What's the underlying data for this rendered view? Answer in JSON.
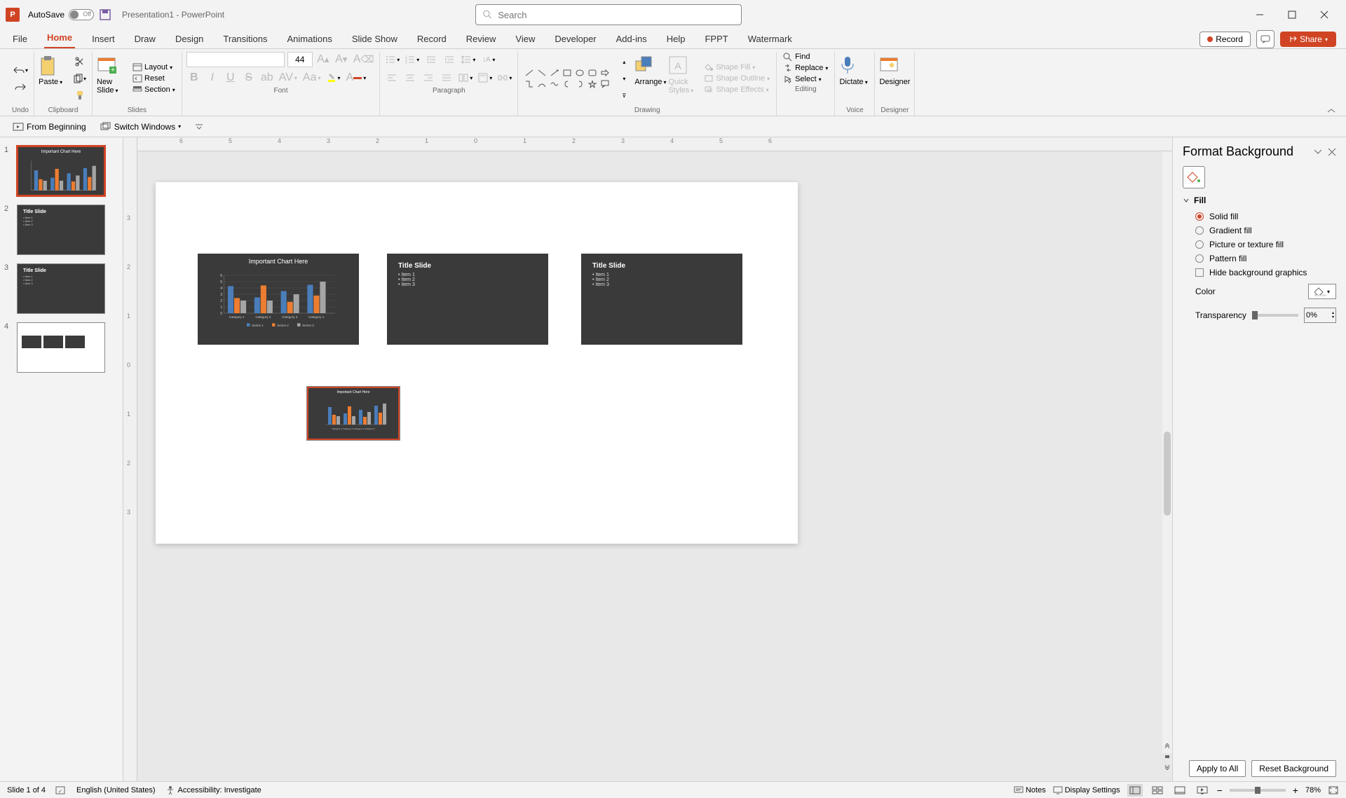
{
  "titlebar": {
    "autosave_label": "AutoSave",
    "autosave_state": "Off",
    "doc_title": "Presentation1 - PowerPoint",
    "search_placeholder": "Search"
  },
  "tabs": [
    "File",
    "Home",
    "Insert",
    "Draw",
    "Design",
    "Transitions",
    "Animations",
    "Slide Show",
    "Record",
    "Review",
    "View",
    "Developer",
    "Add-ins",
    "Help",
    "FPPT",
    "Watermark"
  ],
  "active_tab": "Home",
  "tab_right": {
    "record": "Record",
    "share": "Share"
  },
  "ribbon": {
    "undo_group": "Undo",
    "clipboard": {
      "label": "Clipboard",
      "paste": "Paste"
    },
    "slides": {
      "label": "Slides",
      "new_slide": "New Slide",
      "layout": "Layout",
      "reset": "Reset",
      "section": "Section"
    },
    "font": {
      "label": "Font",
      "size": "44"
    },
    "paragraph": {
      "label": "Paragraph"
    },
    "shapes_group": {
      "label": "Drawing",
      "arrange": "Arrange",
      "quick_styles": "Quick Styles",
      "shape_fill": "Shape Fill",
      "shape_outline": "Shape Outline",
      "shape_effects": "Shape Effects"
    },
    "editing": {
      "label": "Editing",
      "find": "Find",
      "replace": "Replace",
      "select": "Select"
    },
    "voice": {
      "label": "Voice",
      "dictate": "Dictate"
    },
    "designer": {
      "label": "Designer",
      "designer": "Designer"
    }
  },
  "qat": {
    "from_beginning": "From Beginning",
    "switch_windows": "Switch Windows"
  },
  "ruler_marks_h": [
    "6",
    "5",
    "4",
    "3",
    "2",
    "1",
    "0",
    "1",
    "2",
    "3",
    "4",
    "5",
    "6"
  ],
  "ruler_marks_v": [
    "3",
    "2",
    "1",
    "0",
    "1",
    "2",
    "3"
  ],
  "thumbnails": [
    {
      "num": "1",
      "type": "chart",
      "title": "Important Chart Here"
    },
    {
      "num": "2",
      "type": "title",
      "title": "Title Slide",
      "items": [
        "Item 1",
        "Item 2",
        "Item 3"
      ]
    },
    {
      "num": "3",
      "type": "title",
      "title": "Title Slide",
      "items": [
        "Item 1",
        "Item 2",
        "Item 3"
      ]
    },
    {
      "num": "4",
      "type": "overview"
    }
  ],
  "slide_objects": {
    "chart_slide": {
      "title": "Important Chart Here"
    },
    "title_slide_1": {
      "title": "Title Slide",
      "items": [
        "• Item 1",
        "• Item 2",
        "• Item 3"
      ]
    },
    "title_slide_2": {
      "title": "Title Slide",
      "items": [
        "• Item 1",
        "• Item 2",
        "• Item 3"
      ]
    },
    "mini_chart": {
      "title": "Important Chart Here"
    }
  },
  "format_pane": {
    "title": "Format Background",
    "section": "Fill",
    "options": {
      "solid": "Solid fill",
      "gradient": "Gradient fill",
      "picture": "Picture or texture fill",
      "pattern": "Pattern fill",
      "hide_bg": "Hide background graphics"
    },
    "color_label": "Color",
    "transparency_label": "Transparency",
    "transparency_value": "0%",
    "apply_all": "Apply to All",
    "reset": "Reset Background"
  },
  "statusbar": {
    "slide_info": "Slide 1 of 4",
    "language": "English (United States)",
    "accessibility": "Accessibility: Investigate",
    "notes": "Notes",
    "display_settings": "Display Settings",
    "zoom": "78%"
  },
  "chart_data": {
    "type": "bar",
    "title": "Important Chart Here",
    "categories": [
      "Category 1",
      "Category 2",
      "Category 3",
      "Category 4"
    ],
    "series": [
      {
        "name": "Series 1",
        "values": [
          4.3,
          2.5,
          3.5,
          4.5
        ]
      },
      {
        "name": "Series 2",
        "values": [
          2.4,
          4.4,
          1.8,
          2.8
        ]
      },
      {
        "name": "Series 3",
        "values": [
          2.0,
          2.0,
          3.0,
          5.0
        ]
      }
    ],
    "ylim": [
      0,
      6
    ],
    "colors": [
      "#4a7ebb",
      "#ed7d31",
      "#a5a5a5"
    ]
  }
}
